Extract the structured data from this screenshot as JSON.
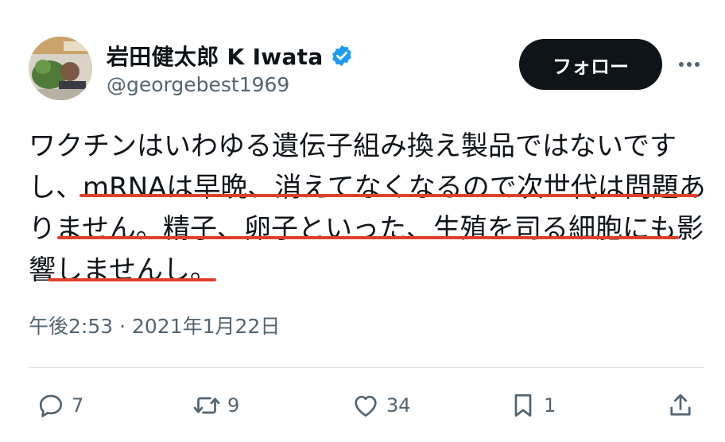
{
  "author": {
    "display_name": "岩田健太郎 K Iwata",
    "handle": "@georgebest1969"
  },
  "follow_label": "フォロー",
  "tweet": {
    "lines": [
      "ワクチンはいわゆる遺伝子組み換え製品ではないです",
      "し、mRNAは早晩、消えてなくなるので次世代は問題あ",
      "りません。精子、卵子といった、生殖を司る細胞にも影",
      "響しませんし。"
    ]
  },
  "timestamp": "午後2:53 · 2021年1月22日",
  "actions": {
    "reply_count": "7",
    "retweet_count": "9",
    "like_count": "34",
    "bookmark_count": "1"
  },
  "colors": {
    "underline": "#e0402b",
    "verified": "#1d9bf0",
    "follow_bg": "#0f1419",
    "secondary_text": "#536471"
  },
  "icons": [
    "avatar",
    "verified-badge-icon",
    "more-icon",
    "reply-icon",
    "retweet-icon",
    "like-icon",
    "bookmark-icon",
    "share-icon"
  ]
}
